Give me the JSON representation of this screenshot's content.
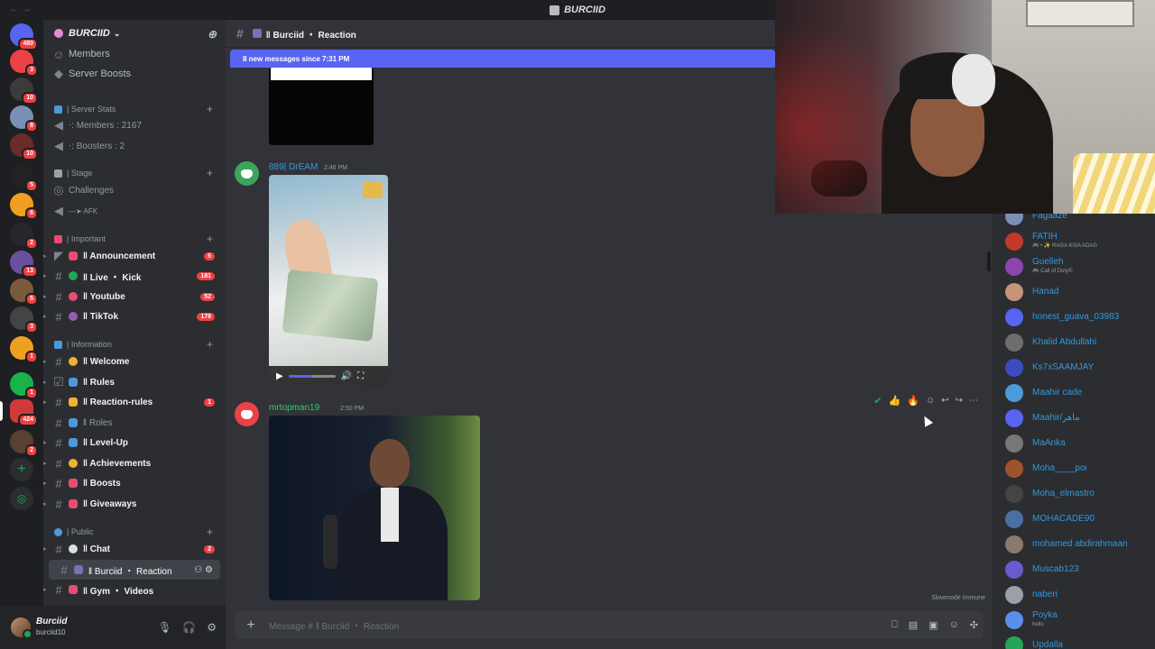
{
  "window": {
    "title": "BURCIID"
  },
  "rail": {
    "servers": [
      {
        "badge": "480",
        "color": "#5865f2"
      },
      {
        "badge": "3",
        "color": "#ed4245"
      },
      {
        "badge": "10",
        "color": "#3b3b3b"
      },
      {
        "badge": "8",
        "color": "#7a8fb5"
      },
      {
        "badge": "10",
        "color": "#6b2b2b"
      },
      {
        "badge": "5",
        "color": "#222222"
      },
      {
        "badge": "6",
        "color": "#f0a020"
      },
      {
        "badge": "2",
        "color": "#1e1f22"
      },
      {
        "badge": "13",
        "color": "#6a4fa0"
      },
      {
        "badge": "5",
        "color": "#7a5a3a"
      },
      {
        "badge": "3",
        "color": "#444444"
      },
      {
        "badge": "1",
        "color": "#f0a020"
      },
      {
        "badge": "1",
        "color": "#18b34b"
      },
      {
        "badge": "424",
        "color": "#d03a3a"
      },
      {
        "badge": "2",
        "color": "#5a4030"
      }
    ]
  },
  "sidebar": {
    "server_name": "BURCIID",
    "top_items": [
      "Members",
      "Server Boosts"
    ],
    "categories": {
      "server_stats": "| Server Stats",
      "stage": "| Stage",
      "important": "| Important",
      "information": "| Information",
      "public": "| Public"
    },
    "stats": [
      "⋅: Members : 2167",
      "⋅: Boosters : 2"
    ],
    "stage_items": [
      "Challenges",
      "---➤ AFK"
    ],
    "important_channels": [
      {
        "name": "‖ Announcement",
        "count": "6"
      },
      {
        "name": "‖ Live ・ Kick",
        "count": "181"
      },
      {
        "name": "‖ Youtube",
        "count": "52"
      },
      {
        "name": "‖ TikTok",
        "count": "178"
      }
    ],
    "info_channels": [
      {
        "name": "‖ Welcome",
        "count": ""
      },
      {
        "name": "‖ Rules",
        "count": ""
      },
      {
        "name": "‖ Reaction-rules",
        "count": "1"
      },
      {
        "name": "‖ Roles",
        "count": ""
      },
      {
        "name": "‖ Level-Up",
        "count": ""
      },
      {
        "name": "‖ Achievements",
        "count": ""
      },
      {
        "name": "‖ Boosts",
        "count": ""
      },
      {
        "name": "‖ Giveaways",
        "count": ""
      }
    ],
    "public_channels": [
      {
        "name": "‖ Chat",
        "count": "2"
      },
      {
        "name": "‖ Burciid ・ Reaction",
        "count": ""
      },
      {
        "name": "‖ Gym ・ Videos",
        "count": ""
      }
    ]
  },
  "user": {
    "display_name": "Burciid",
    "username": "burciid10"
  },
  "chat": {
    "channel_title": "‖ Burciid ・ Reaction",
    "new_messages": "8 new messages since 7:31 PM",
    "messages": [
      {
        "author": "889| DrEAM",
        "time": "2:46 PM"
      },
      {
        "author": "mrtopman19",
        "time": "2:50 PM"
      }
    ],
    "slowmode": "Slowmode Immune",
    "composer_placeholder": "Message # ‖ Burciid ・ Reaction"
  },
  "members": [
    {
      "name": "Fagaaze",
      "status": ""
    },
    {
      "name": "FATIH",
      "status": "🎮 • ✨ RAGA KISA ADAG"
    },
    {
      "name": "Guelleh",
      "status": "🎮 Call of Duty®"
    },
    {
      "name": "Hanad",
      "status": ""
    },
    {
      "name": "honest_guava_03983",
      "status": ""
    },
    {
      "name": "Khalid Abdullahi",
      "status": ""
    },
    {
      "name": "Ks7xSAAMJAY",
      "status": ""
    },
    {
      "name": "Maahir cade",
      "status": ""
    },
    {
      "name": "Maahir/ماهر",
      "status": ""
    },
    {
      "name": "MaAnka",
      "status": ""
    },
    {
      "name": "Moha____poi",
      "status": ""
    },
    {
      "name": "Moha_elmastro",
      "status": ""
    },
    {
      "name": "MOHACADE90",
      "status": ""
    },
    {
      "name": "mohamed abdirahmaan",
      "status": ""
    },
    {
      "name": "Muscab123",
      "status": ""
    },
    {
      "name": "naberi",
      "status": ""
    },
    {
      "name": "Poyka",
      "status": "hello"
    },
    {
      "name": "Updalla",
      "status": ""
    }
  ],
  "colors": {
    "accent": "#5865f2",
    "badge": "#f23f43",
    "member_name": "#3498db",
    "author_green": "#2ecc71"
  }
}
